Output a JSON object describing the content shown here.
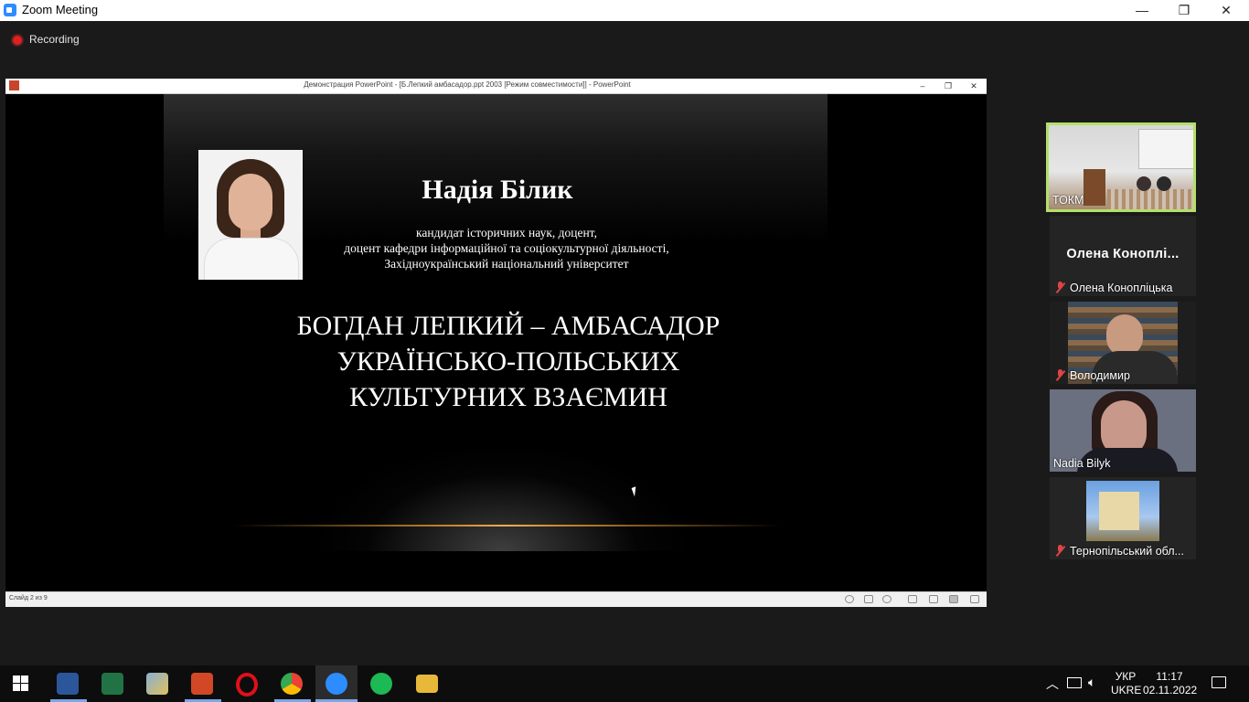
{
  "window": {
    "title": "Zoom Meeting",
    "controls": {
      "minimize": "—",
      "restore": "❐",
      "close": "✕"
    }
  },
  "recording": {
    "label": "Recording"
  },
  "powerpoint": {
    "title": "Демонстрация PowerPoint - [Б.Лепкий амбасадор.ppt 2003 [Режим совместимости]] - PowerPoint",
    "status": "Слайд 2 из 9",
    "controls": {
      "minimize": "–",
      "restore": "❐",
      "close": "✕"
    }
  },
  "slide": {
    "name": "Надія Білик",
    "affiliation": [
      "кандидат історичних наук, доцент,",
      "доцент кафедри інформаційної та соціокультурної діяльності,",
      "Західноукраїнський національний університет"
    ],
    "title_lines": [
      "БОГДАН ЛЕПКИЙ – АМБАСАДОР",
      "УКРАЇНСЬКО-ПОЛЬСЬКИХ",
      "КУЛЬТУРНИХ ВЗАЄМИН"
    ]
  },
  "participants": [
    {
      "name": "ТОКМ",
      "muted": false,
      "active": true
    },
    {
      "name": "Олена Коноплiцька",
      "display": "Олена  Коноплі...",
      "muted": true
    },
    {
      "name": "Володимир",
      "muted": true
    },
    {
      "name": "Nadia Bilyk",
      "muted": false
    },
    {
      "name": "Тернопільський обл...",
      "muted": true
    }
  ],
  "taskbar": {
    "apps": [
      "start-icon",
      "word-icon",
      "excel-icon",
      "paint-icon",
      "powerpoint-icon",
      "opera-icon",
      "chrome-icon",
      "zoom-icon",
      "spotify-icon",
      "file-explorer-icon"
    ],
    "lang_top": "УКР",
    "lang_bottom": "UKRE",
    "time": "11:17",
    "date": "02.11.2022"
  },
  "colors": {
    "active_speaker_border": "#b3e06a",
    "recording_dot": "#e02020",
    "zoom_blue": "#2d8cff"
  }
}
